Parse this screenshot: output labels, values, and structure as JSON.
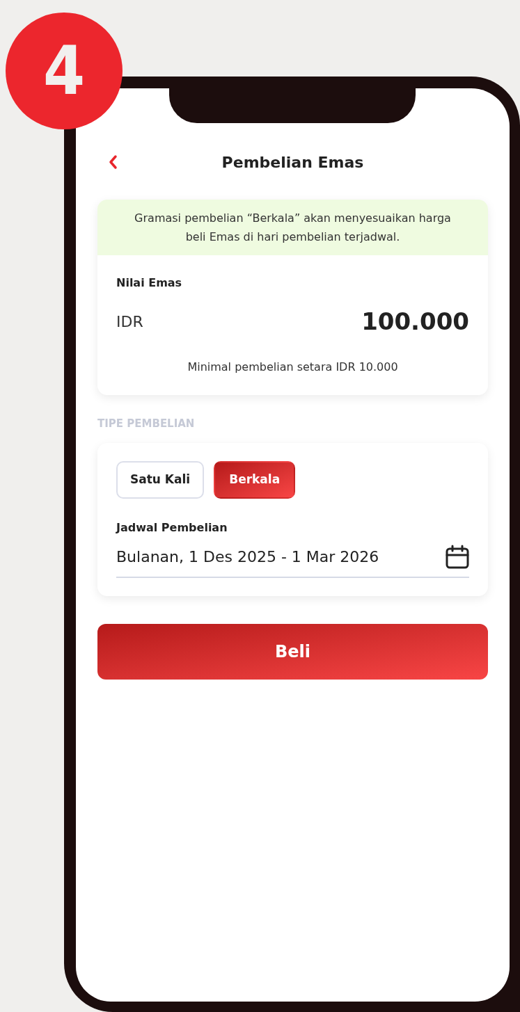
{
  "step_badge": "4",
  "header": {
    "title": "Pembelian Emas"
  },
  "info_banner": "Gramasi pembelian “Berkala” akan menyesuaikan harga beli Emas di hari pembelian terjadwal.",
  "amount_card": {
    "label": "Nilai Emas",
    "currency": "IDR",
    "amount": "100.000",
    "minimum_note": "Minimal pembelian setara IDR 10.000"
  },
  "purchase_type": {
    "section_label": "TIPE PEMBELIAN",
    "options": [
      {
        "label": "Satu Kali",
        "selected": false
      },
      {
        "label": "Berkala",
        "selected": true
      }
    ],
    "schedule_label": "Jadwal Pembelian",
    "schedule_value": "Bulanan, 1 Des 2025 - 1 Mar 2026"
  },
  "buy_button": "Beli"
}
